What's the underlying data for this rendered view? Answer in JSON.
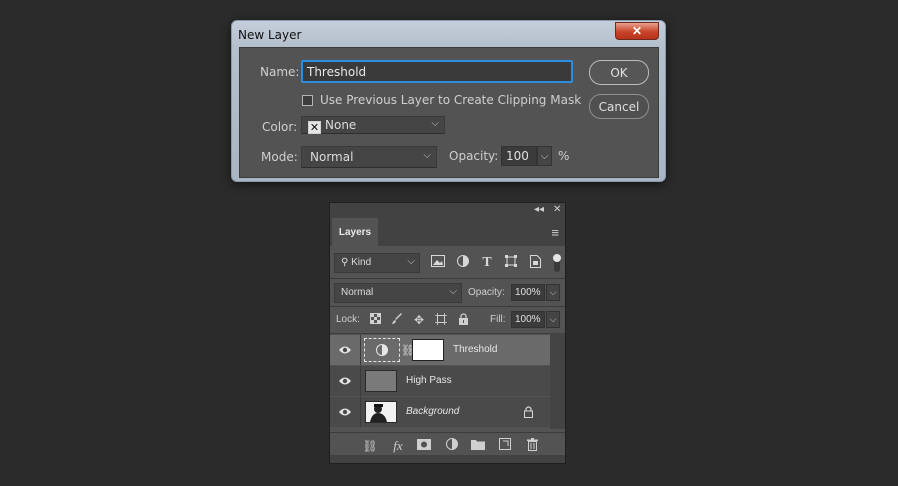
{
  "dialog": {
    "title": "New Layer",
    "close_glyph": "✕",
    "name_label": "Name:",
    "name_value": "Threshold",
    "clipping_label": "Use Previous Layer to Create Clipping Mask",
    "color_label": "Color:",
    "color_value": "None",
    "mode_label": "Mode:",
    "mode_value": "Normal",
    "opacity_label": "Opacity:",
    "opacity_value": "100",
    "opacity_unit": "%",
    "ok_label": "OK",
    "cancel_label": "Cancel"
  },
  "layers_panel": {
    "tab_label": "Layers",
    "collapse_glyph": "◂◂",
    "close_glyph": "✕",
    "filter_kind": "Kind",
    "blend_mode": "Normal",
    "opacity_label": "Opacity:",
    "opacity_value": "100%",
    "lock_label": "Lock:",
    "fill_label": "Fill:",
    "fill_value": "100%",
    "layers": [
      {
        "name": "Threshold",
        "selected": true
      },
      {
        "name": "High Pass",
        "selected": false
      },
      {
        "name": "Background",
        "selected": false,
        "locked": true
      }
    ],
    "bottom_fx_label": "fx"
  },
  "colors": {
    "accent_focus": "#2a8fe0",
    "dialog_bg": "#535353",
    "panel_bg": "#535353",
    "selected_row": "#6a6a6a"
  }
}
